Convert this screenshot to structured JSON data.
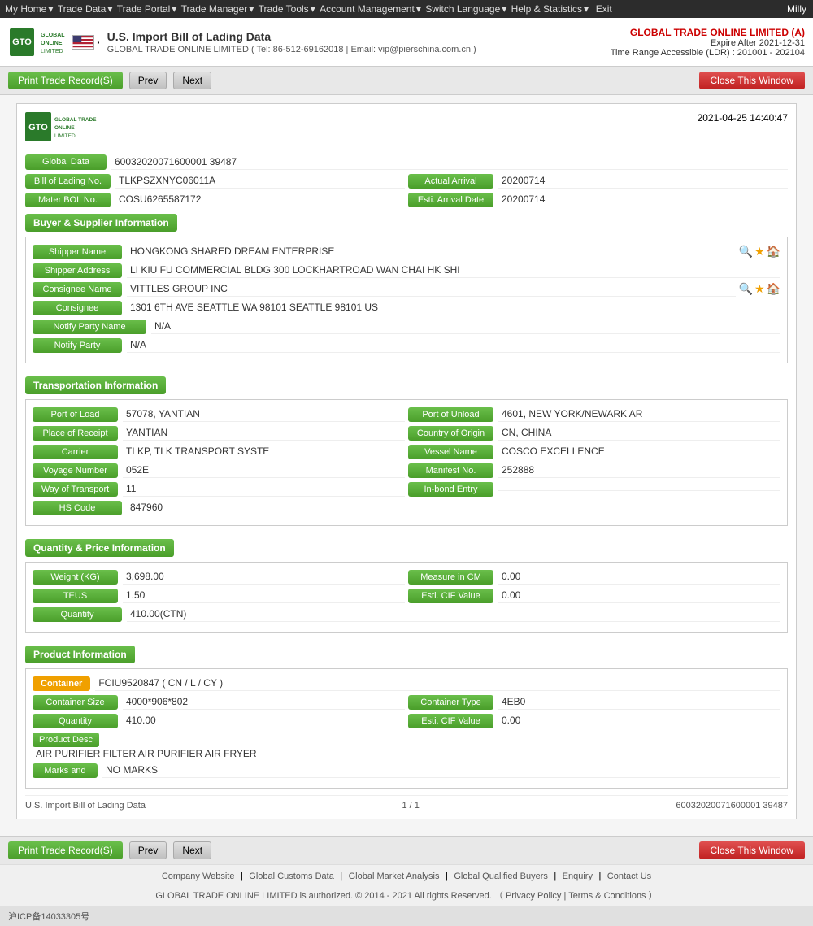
{
  "topnav": {
    "items": [
      "My Home",
      "Trade Data",
      "Trade Portal",
      "Trade Manager",
      "Trade Tools",
      "Account Management",
      "Switch Language",
      "Help & Statistics",
      "Exit"
    ],
    "user": "Milly"
  },
  "header": {
    "flag": "US",
    "separator": "·",
    "title": "U.S. Import Bill of Lading Data",
    "subline": "GLOBAL TRADE ONLINE LIMITED ( Tel: 86-512-69162018 | Email: vip@pierschina.com.cn )",
    "company": "GLOBAL TRADE ONLINE LIMITED (A)",
    "expire": "Expire After 2021-12-31",
    "time_range": "Time Range Accessible (LDR) : 201001 - 202104"
  },
  "toolbar": {
    "print_label": "Print Trade Record(S)",
    "prev_label": "Prev",
    "next_label": "Next",
    "close_label": "Close This Window"
  },
  "record": {
    "datetime": "2021-04-25 14:40:47",
    "global_data_label": "Global Data",
    "global_data_value": "60032020071600001 39487",
    "bol_label": "Bill of Lading No.",
    "bol_value": "TLKPSZXNYC06011A",
    "actual_arrival_label": "Actual Arrival",
    "actual_arrival_value": "20200714",
    "mater_bol_label": "Mater BOL No.",
    "mater_bol_value": "COSU6265587172",
    "esti_arrival_label": "Esti. Arrival Date",
    "esti_arrival_value": "20200714"
  },
  "buyer_supplier": {
    "section_title": "Buyer & Supplier Information",
    "shipper_name_label": "Shipper Name",
    "shipper_name_value": "HONGKONG SHARED DREAM ENTERPRISE",
    "shipper_address_label": "Shipper Address",
    "shipper_address_value": "LI KIU FU COMMERCIAL BLDG 300 LOCKHARTROAD WAN CHAI HK SHI",
    "consignee_name_label": "Consignee Name",
    "consignee_name_value": "VITTLES GROUP INC",
    "consignee_label": "Consignee",
    "consignee_value": "1301 6TH AVE SEATTLE WA 98101 SEATTLE 98101 US",
    "notify_party_name_label": "Notify Party Name",
    "notify_party_name_value": "N/A",
    "notify_party_label": "Notify Party",
    "notify_party_value": "N/A"
  },
  "transportation": {
    "section_title": "Transportation Information",
    "port_of_load_label": "Port of Load",
    "port_of_load_value": "57078, YANTIAN",
    "port_of_unload_label": "Port of Unload",
    "port_of_unload_value": "4601, NEW YORK/NEWARK AR",
    "place_of_receipt_label": "Place of Receipt",
    "place_of_receipt_value": "YANTIAN",
    "country_of_origin_label": "Country of Origin",
    "country_of_origin_value": "CN, CHINA",
    "carrier_label": "Carrier",
    "carrier_value": "TLKP, TLK TRANSPORT SYSTE",
    "vessel_name_label": "Vessel Name",
    "vessel_name_value": "COSCO EXCELLENCE",
    "voyage_label": "Voyage Number",
    "voyage_value": "052E",
    "manifest_label": "Manifest No.",
    "manifest_value": "252888",
    "way_of_transport_label": "Way of Transport",
    "way_of_transport_value": "11",
    "in_bond_label": "In-bond Entry",
    "in_bond_value": "",
    "hs_code_label": "HS Code",
    "hs_code_value": "847960"
  },
  "quantity_price": {
    "section_title": "Quantity & Price Information",
    "weight_label": "Weight (KG)",
    "weight_value": "3,698.00",
    "measure_label": "Measure in CM",
    "measure_value": "0.00",
    "teus_label": "TEUS",
    "teus_value": "1.50",
    "esti_cif_label": "Esti. CIF Value",
    "esti_cif_value": "0.00",
    "quantity_label": "Quantity",
    "quantity_value": "410.00(CTN)"
  },
  "product": {
    "section_title": "Product Information",
    "container_label": "Container",
    "container_value": "FCIU9520847 ( CN / L / CY )",
    "container_size_label": "Container Size",
    "container_size_value": "4000*906*802",
    "container_type_label": "Container Type",
    "container_type_value": "4EB0",
    "quantity_label": "Quantity",
    "quantity_value": "410.00",
    "esti_cif_label": "Esti. CIF Value",
    "esti_cif_value": "0.00",
    "product_desc_label": "Product Desc",
    "product_desc_value": "AIR PURIFIER FILTER AIR PURIFIER AIR FRYER",
    "marks_label": "Marks and",
    "marks_value": "NO MARKS"
  },
  "record_footer": {
    "source": "U.S. Import Bill of Lading Data",
    "page": "1 / 1",
    "record_id": "60032020071600001 39487"
  },
  "footer": {
    "links": [
      "Company Website",
      "Global Customs Data",
      "Global Market Analysis",
      "Global Qualified Buyers",
      "Enquiry",
      "Contact Us"
    ],
    "copyright": "GLOBAL TRADE ONLINE LIMITED is authorized. © 2014 - 2021 All rights Reserved.  （",
    "privacy": "Privacy Policy",
    "separator": "|",
    "terms": "Terms & Conditions",
    "end": "）",
    "icp": "沪ICP备14033305号"
  }
}
